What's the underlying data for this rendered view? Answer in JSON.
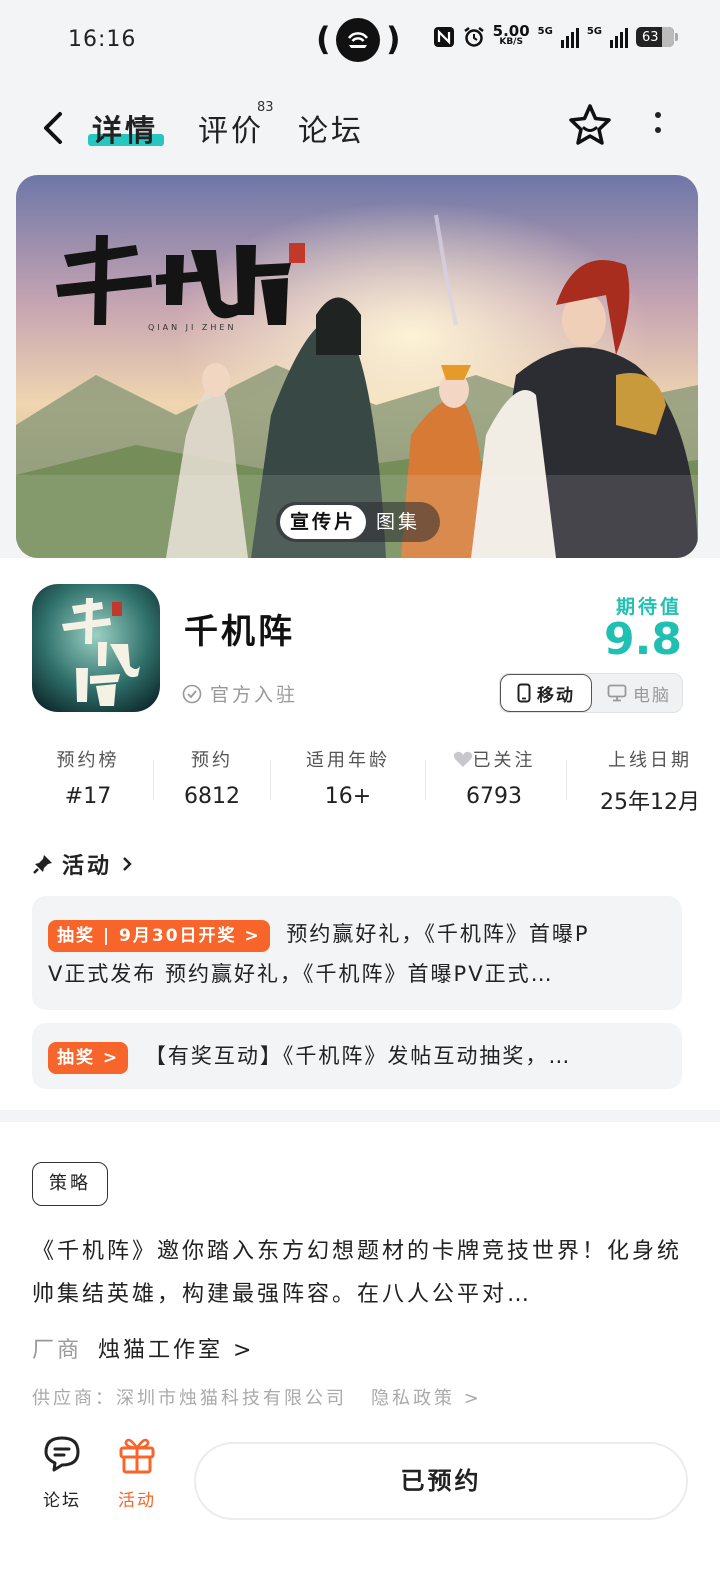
{
  "status_bar": {
    "time": "16:16",
    "net_speed": "5.00",
    "net_unit": "KB/S",
    "sim1": "5G",
    "sim2": "5G",
    "battery": "63"
  },
  "nav": {
    "tabs": [
      {
        "label": "详情",
        "active": true
      },
      {
        "label": "评价",
        "badge": "83"
      },
      {
        "label": "论坛"
      }
    ],
    "icons": [
      "back-icon",
      "favorite-star-icon",
      "more-icon"
    ]
  },
  "banner": {
    "media_tabs": [
      {
        "label": "宣传片",
        "active": true
      },
      {
        "label": "图集"
      }
    ]
  },
  "app": {
    "name": "千机阵",
    "official": "官方入驻",
    "expect_label": "期待值",
    "expect_value": "9.8",
    "platforms": [
      {
        "label": "移动",
        "active": true
      },
      {
        "label": "电脑",
        "active": false
      }
    ]
  },
  "stats": [
    {
      "label": "预约榜",
      "value": "#17"
    },
    {
      "label": "预约",
      "value": "6812"
    },
    {
      "label": "适用年龄",
      "value": "16+"
    },
    {
      "label": "已关注",
      "value": "6793"
    },
    {
      "label": "上线日期",
      "value": "25年12月"
    }
  ],
  "activities": {
    "title": "活动",
    "items": [
      {
        "pill": "抽奖 | 9月30日开奖 >",
        "text": "预约赢好礼，《千机阵》首曝P",
        "text2": "V正式发布 预约赢好礼，《千机阵》首曝PV正式…"
      },
      {
        "pill": "抽奖 >",
        "text": "【有奖互动】《千机阵》发帖互动抽奖，…"
      }
    ]
  },
  "details": {
    "tag": "策略",
    "description": "《千机阵》邀你踏入东方幻想题材的卡牌竞技世界！化身统帅集结英雄，构建最强阵容。在八人公平对…",
    "vendor_label": "厂商",
    "vendor_name": "烛猫工作室 >",
    "supplier": "供应商：深圳市烛猫科技有限公司",
    "privacy": "隐私政策 >"
  },
  "bottom_bar": {
    "forum": "论坛",
    "activity": "活动",
    "reserve_button": "已预约"
  },
  "colors": {
    "accent_teal": "#25c7c0",
    "accent_orange": "#f8652b"
  }
}
